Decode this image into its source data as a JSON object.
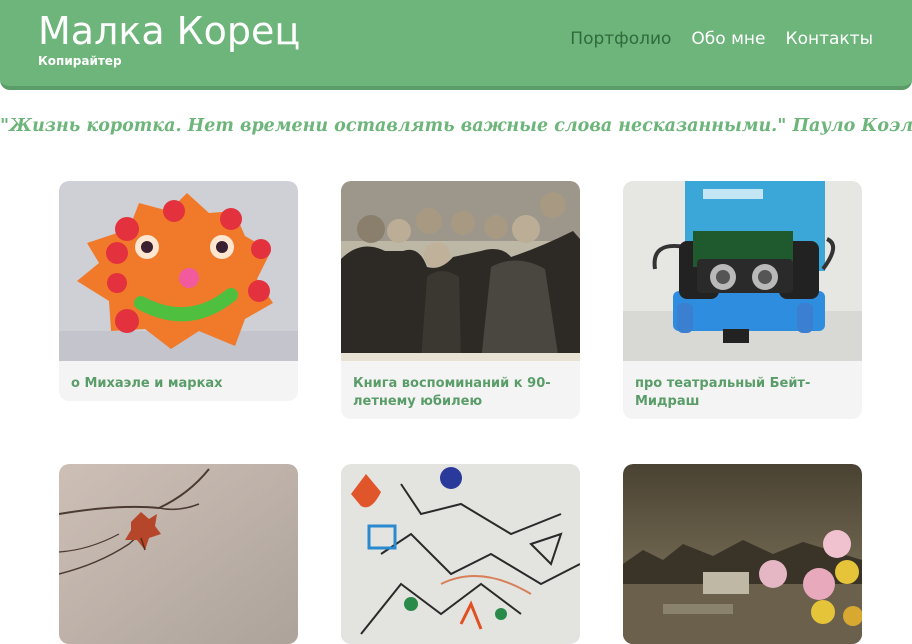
{
  "header": {
    "title": "Малка Корец",
    "subtitle": "Копирайтер",
    "nav": [
      {
        "label": "Портфолио",
        "active": true
      },
      {
        "label": "Обо мне",
        "active": false
      },
      {
        "label": "Контакты",
        "active": false
      }
    ]
  },
  "quote": "\"Жизнь коротка. Нет времени оставлять важные слова несказанными.\" Пауло Коэльо.",
  "portfolio": {
    "cards": [
      {
        "caption": "о Михаэле и марках",
        "image": "plasticine-sun-image"
      },
      {
        "caption": "Книга воспоминаний к 90-летнему юбилею",
        "image": "family-photo-image"
      },
      {
        "caption": "про театральный Бейт-Мидраш",
        "image": "robot-toy-image"
      },
      {
        "caption": "",
        "image": "autumn-leaf-image"
      },
      {
        "caption": "",
        "image": "child-drawing-image"
      },
      {
        "caption": "",
        "image": "flowers-ruins-image"
      }
    ]
  },
  "colors": {
    "brand_green": "#6db57a",
    "nav_active": "#2f6b3c",
    "caption_green": "#5a9d69",
    "card_bg": "#f4f4f4"
  }
}
